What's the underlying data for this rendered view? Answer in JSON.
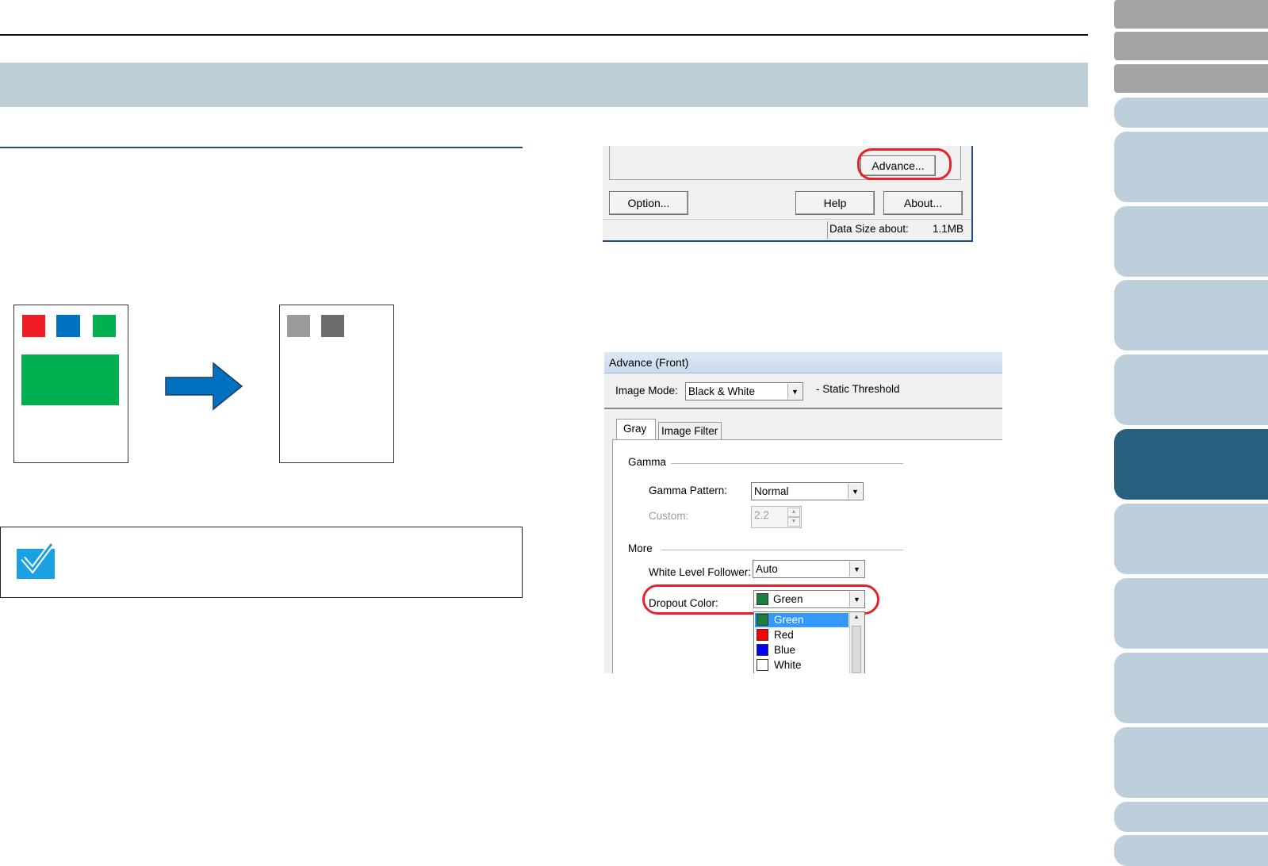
{
  "colors": {
    "title_band": "#bfcfd9",
    "side_gray": "#a3a3a3",
    "side_blue": "#bccfdb",
    "side_active": "#285f7e",
    "highlight_ring": "#e8202a",
    "chip_red": "#ee1c25",
    "chip_blue": "#0070c0",
    "chip_green": "#00b050",
    "chip_gray_light": "#9a9a9a",
    "chip_gray_dark": "#6b6b6b",
    "arrow": "#0070c0",
    "note_icon": "#1ba1e2"
  },
  "note": {
    "icon": "checkmark-icon"
  },
  "scanner_dialog": {
    "advance_button": "Advance...",
    "option_button": "Option...",
    "help_button": "Help",
    "about_button": "About...",
    "data_size_label": "Data Size about:",
    "data_size_value": "1.1MB"
  },
  "advance_dialog": {
    "title": "Advance (Front)",
    "image_mode_label": "Image Mode:",
    "image_mode_value": "Black & White",
    "threshold_text": "- Static Threshold",
    "tabs": [
      "Gray",
      "Image Filter"
    ],
    "gamma_group": "Gamma",
    "gamma_pattern_label": "Gamma Pattern:",
    "gamma_pattern_value": "Normal",
    "custom_label": "Custom:",
    "custom_value": "2.2",
    "more_group": "More",
    "white_level_label": "White Level Follower:",
    "white_level_value": "Auto",
    "dropout_label": "Dropout Color:",
    "dropout_value": "Green",
    "dropout_options": [
      {
        "label": "Green",
        "color": "#1a7f3c"
      },
      {
        "label": "Red",
        "color": "#ff0000"
      },
      {
        "label": "Blue",
        "color": "#0000ff"
      },
      {
        "label": "White",
        "color": "#ffffff"
      }
    ]
  }
}
